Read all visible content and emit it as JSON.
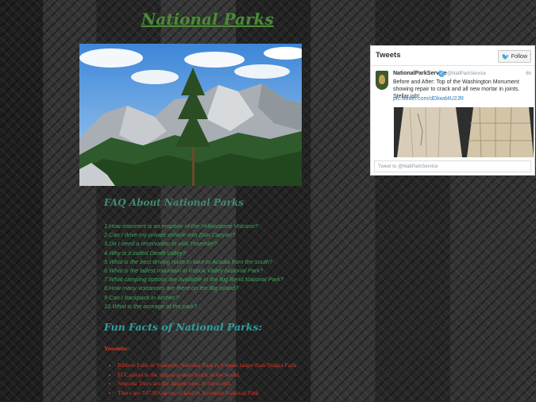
{
  "page": {
    "title": "National Parks"
  },
  "faq": {
    "title": "FAQ About National Parks",
    "items": [
      "1.How imminent is an eruption of the Yellowstone Volcano?",
      "2.Can I drive my private vehicle into Zion Canyon?",
      "3.Do I need a reservation to visit Yosemite?",
      "4.Why is it called Death Valley?",
      "5.What is the best driving route to take to Acadia from the south?",
      "6.What is the tallest mountain in Kobuk Valley National Park?",
      "7.What camping options are available in the Big Bend National Park?",
      "8.How many volcanoes are there on the Big Island?",
      "9.Can I backpack in Arches?",
      "10.What is the acreage of the park?"
    ]
  },
  "fun_facts": {
    "title": "Fun Facts of National Parks:",
    "section_label": "Yosemite:",
    "items": [
      "Ribbon Falls in Yosemite National Park is 9 times larger than Niagra Falls.",
      "El Capitan is the largest granite block in the world.",
      "Sequoia Trees are the largest trees in the world.",
      "There are 747,956 acres of land in Yosemite National Park."
    ]
  },
  "twitter": {
    "header": "Tweets",
    "follow_label": "Follow",
    "tweet": {
      "name": "NationalParkService",
      "verified_mark": "✓",
      "handle": "@NatlParkService",
      "time": "6h",
      "text": "Before and After: Top of the Washington Monument showing repair to crack and all new mortar in joints. Stellar job!",
      "link": "pic.twitter.com/dDkwd4U2JR"
    },
    "reply_placeholder": "Tweet to @NatlParkService"
  },
  "icons": {
    "bird": "twitter-bird-icon",
    "verified": "verified-badge-icon",
    "avatar": "nps-avatar"
  },
  "colors": {
    "title": "#4d8a3a",
    "faq_text": "#3aa357",
    "fun_title": "#2fa0a0",
    "fun_text": "#e0331d",
    "twitter_blue": "#55acee"
  }
}
